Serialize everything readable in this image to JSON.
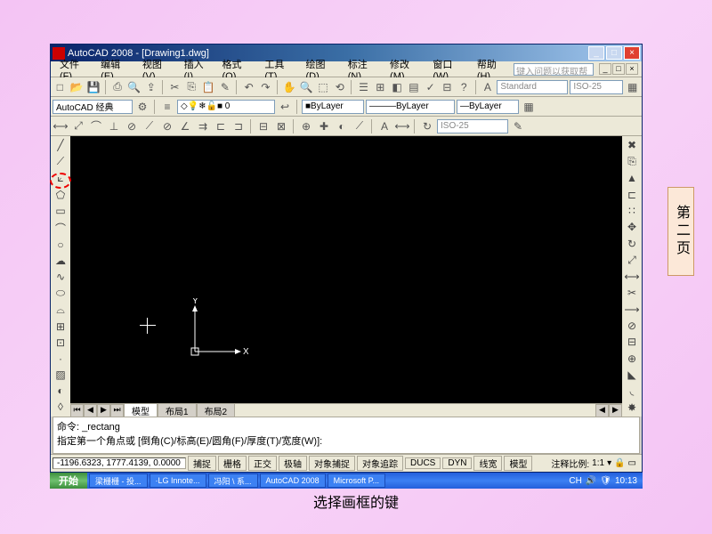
{
  "title": "AutoCAD 2008 - [Drawing1.dwg]",
  "menus": [
    "文件(F)",
    "编辑(E)",
    "视图(V)",
    "插入(I)",
    "格式(O)",
    "工具(T)",
    "绘图(D)",
    "标注(N)",
    "修改(M)",
    "窗口(W)",
    "帮助(H)"
  ],
  "help_placeholder": "键入问题以获取帮助",
  "workspace_combo": "AutoCAD 经典",
  "style_combo": "Standard",
  "iso_combo": "ISO-25",
  "layer_combo": "ByLayer",
  "linetype_combo": "ByLayer",
  "dim_combo": "ISO-25",
  "axis_x": "X",
  "axis_y": "Y",
  "viewtabs": {
    "model": "模型",
    "layout1": "布局1",
    "layout2": "布局2"
  },
  "cmd_line1": "命令:  _rectang",
  "cmd_line2": "指定第一个角点或 [倒角(C)/标高(E)/圆角(F)/厚度(T)/宽度(W)]:",
  "status_coords": "-1196.6323, 1777.4139, 0.0000",
  "status_toggles": [
    "捕捉",
    "栅格",
    "正交",
    "极轴",
    "对象捕捉",
    "对象追踪",
    "DUCS",
    "DYN",
    "线宽",
    "模型"
  ],
  "scale_label": "注释比例:",
  "scale_value": "1:1",
  "start": "开始",
  "task_items": [
    "梁栅栅 - 投...",
    "·LG Innote...",
    "冯阳 \\ 系...",
    "AutoCAD 2008",
    "Microsoft P..."
  ],
  "tray_lang": "CH",
  "tray_time": "10:13",
  "caption": "选择画框的键",
  "page_badge": "第二页"
}
